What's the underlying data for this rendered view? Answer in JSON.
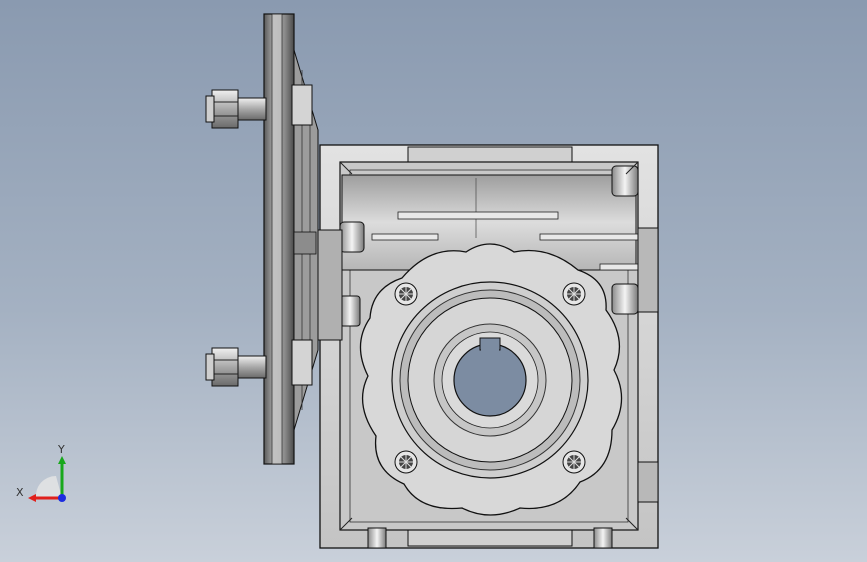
{
  "viewport": {
    "model": "worm-gearbox-with-motor-flange",
    "view": "front"
  },
  "triad": {
    "x_label": "X",
    "y_label": "Y",
    "x_color": "#e0201c",
    "y_color": "#18a81c",
    "z_color": "#1c2ce0"
  },
  "colors": {
    "background_top": "#8a9ab0",
    "background_bottom": "#c9d0da",
    "metal_light": "#d9d9d9",
    "metal_mid": "#b8b8b8",
    "metal_dark": "#7a7a7a",
    "edge": "#1a1a1a"
  }
}
